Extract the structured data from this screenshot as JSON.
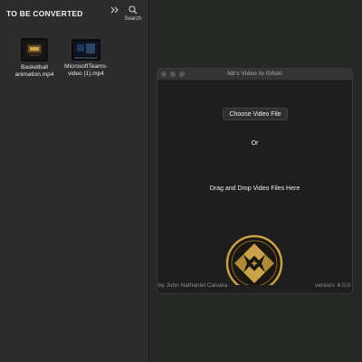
{
  "finder": {
    "title": "TO BE CONVERTED",
    "search_label": "Search",
    "files": [
      {
        "name_line1": "Basketball",
        "name_line2": "animation.mp4"
      },
      {
        "name_line1": "MicrosoftTeams-",
        "name_line2": "video (1).mp4"
      }
    ]
  },
  "app": {
    "title": "N8's Video to Gifski",
    "choose_button": "Choose Video File",
    "or_label": "Or",
    "drop_label": "Drag and Drop Video Files Here",
    "author": "by John Nathaniel Calvara",
    "version": "version: 4.0.0"
  },
  "icons": {
    "expand": "chevron-double-right-icon",
    "search": "magnifier-icon",
    "logo": "gold-emblem-logo"
  },
  "colors": {
    "accent_gold": "#c9a24a",
    "window_bg": "#1e1e1e",
    "finder_bg": "#2b2c2b"
  }
}
